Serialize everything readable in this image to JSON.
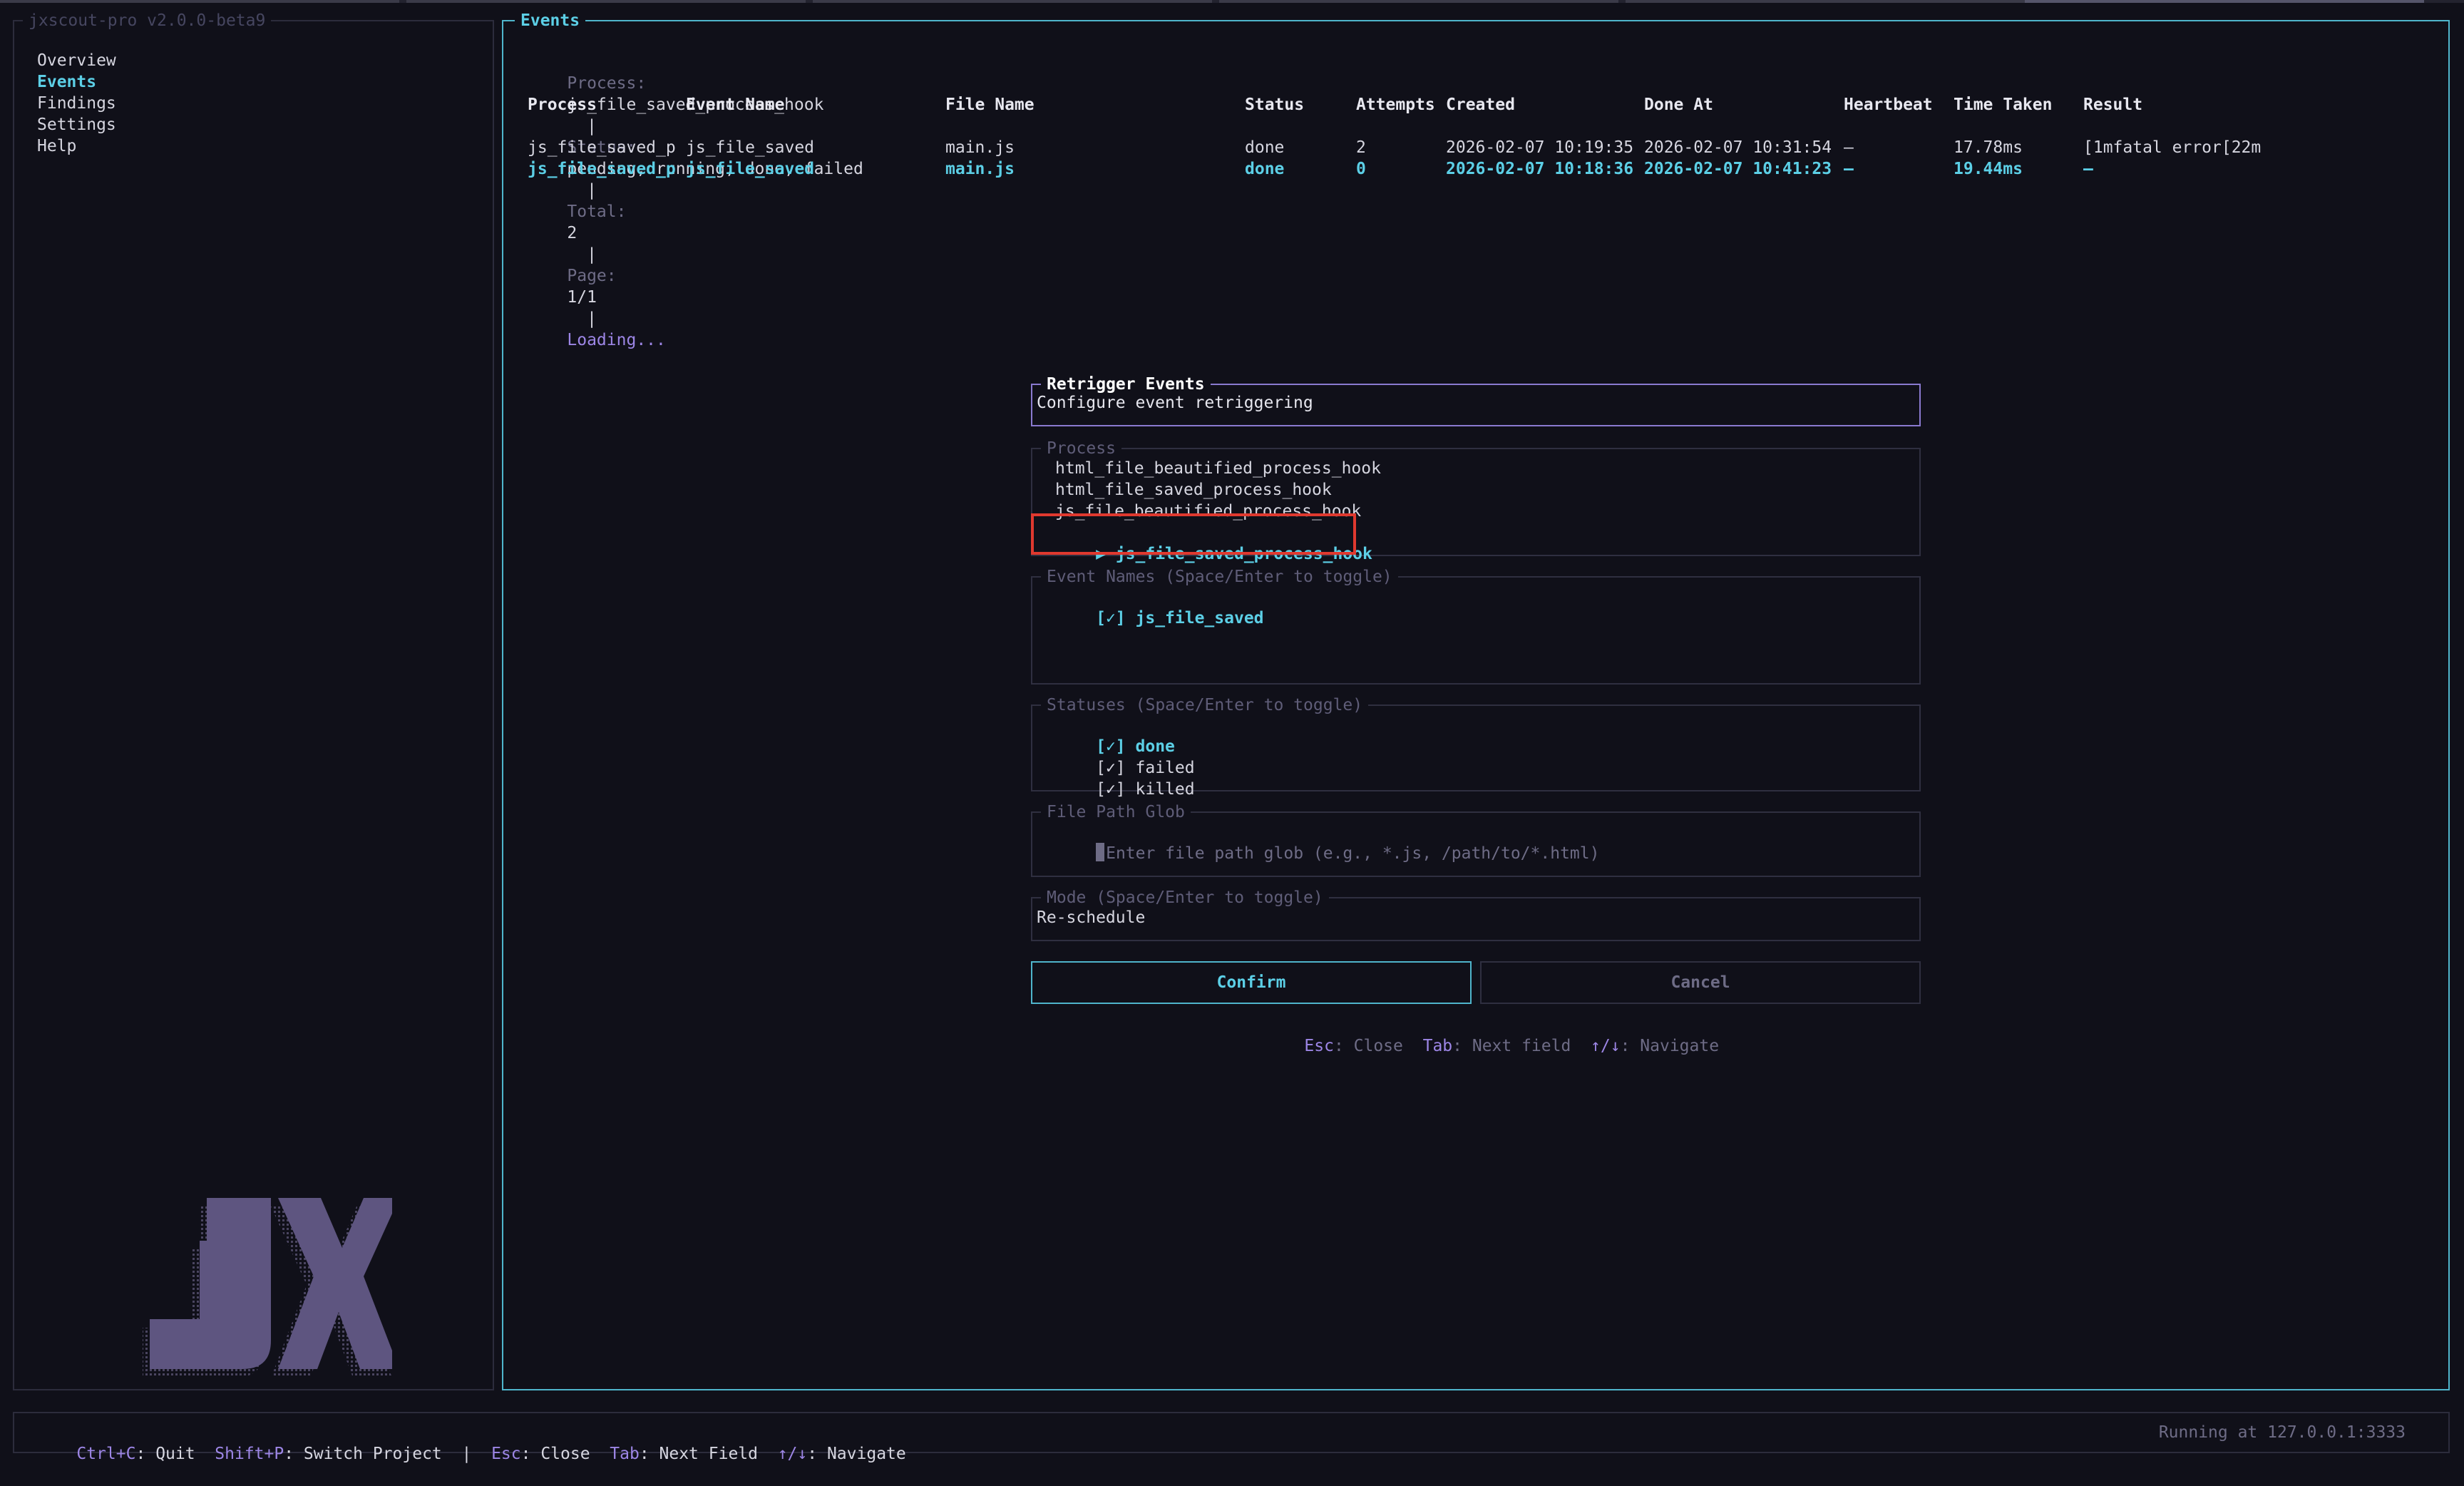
{
  "app": {
    "title": "jxscout-pro v2.0.0-beta9"
  },
  "sidebar": {
    "items": [
      {
        "label": "Overview",
        "active": false
      },
      {
        "label": "Events",
        "active": true
      },
      {
        "label": "Findings",
        "active": false
      },
      {
        "label": "Settings",
        "active": false
      },
      {
        "label": "Help",
        "active": false
      }
    ],
    "logo_text": "JX"
  },
  "events": {
    "title": "Events",
    "summary": {
      "process_label": "Process:",
      "process_value": "js_file_saved_process_hook",
      "status_label": "Status:",
      "status_value": "pending, running, done, failed",
      "total_label": "Total:",
      "total_value": "2",
      "page_label": "Page:",
      "page_value": "1/1",
      "loading": "Loading...",
      "sep": "|"
    },
    "columns": [
      "Process",
      "Event Name",
      "File Name",
      "Status",
      "Attempts",
      "Created",
      "Done At",
      "Heartbeat",
      "Time Taken",
      "Result"
    ],
    "rows": [
      [
        "js_file_saved_p",
        "js_file_saved",
        "main.js",
        "done",
        "2",
        "2026-02-07 10:19:35",
        "2026-02-07 10:31:54",
        "—",
        "17.78ms",
        "[1mfatal error[22m"
      ],
      [
        "js_file_saved_p",
        "js_file_saved",
        "main.js",
        "done",
        "0",
        "2026-02-07 10:18:36",
        "2026-02-07 10:41:23",
        "—",
        "19.44ms",
        "—"
      ]
    ]
  },
  "modal": {
    "title": "Retrigger Events",
    "subtitle": "Configure event retriggering",
    "process": {
      "legend": "Process",
      "options": [
        {
          "label": "html_file_beautified_process_hook",
          "selected": false
        },
        {
          "label": "html_file_saved_process_hook",
          "selected": false
        },
        {
          "label": "js_file_beautified_process_hook",
          "selected": false
        },
        {
          "label": "js_file_saved_process_hook",
          "selected": true
        }
      ],
      "pointer": "▶"
    },
    "event_names": {
      "legend": "Event Names (Space/Enter to toggle)",
      "items": [
        {
          "check": "[✓]",
          "label": "js_file_saved",
          "focused": true
        }
      ]
    },
    "statuses": {
      "legend": "Statuses (Space/Enter to toggle)",
      "items": [
        {
          "check": "[✓]",
          "label": "done",
          "focused": true
        },
        {
          "check": "[✓]",
          "label": "failed",
          "focused": false
        },
        {
          "check": "[✓]",
          "label": "killed",
          "focused": false
        }
      ]
    },
    "file_path_glob": {
      "legend": "File Path Glob",
      "value": "",
      "placeholder": "Enter file path glob (e.g., *.js, /path/to/*.html)"
    },
    "mode": {
      "legend": "Mode (Space/Enter to toggle)",
      "value": "Re-schedule"
    },
    "confirm_label": "Confirm",
    "cancel_label": "Cancel",
    "hints": [
      {
        "key": "Esc",
        "action": "Close"
      },
      {
        "key": "Tab",
        "action": "Next field"
      },
      {
        "key": "↑/↓",
        "action": "Navigate"
      }
    ]
  },
  "footer": {
    "shortcuts": [
      {
        "key": "Ctrl+C",
        "action": "Quit"
      },
      {
        "key": "Shift+P",
        "action": "Switch Project"
      },
      {
        "key": "Esc",
        "action": "Close"
      },
      {
        "key": "Tab",
        "action": "Next Field"
      },
      {
        "key": "↑/↓",
        "action": "Navigate"
      }
    ],
    "sep": "|",
    "status": "Running at 127.0.0.1:3333"
  },
  "colors": {
    "background": "#101019",
    "accent_cyan": "#5ccfe6",
    "accent_purple": "#9d86e6",
    "highlight_red": "#e0392f",
    "logo": "#5e5580"
  }
}
